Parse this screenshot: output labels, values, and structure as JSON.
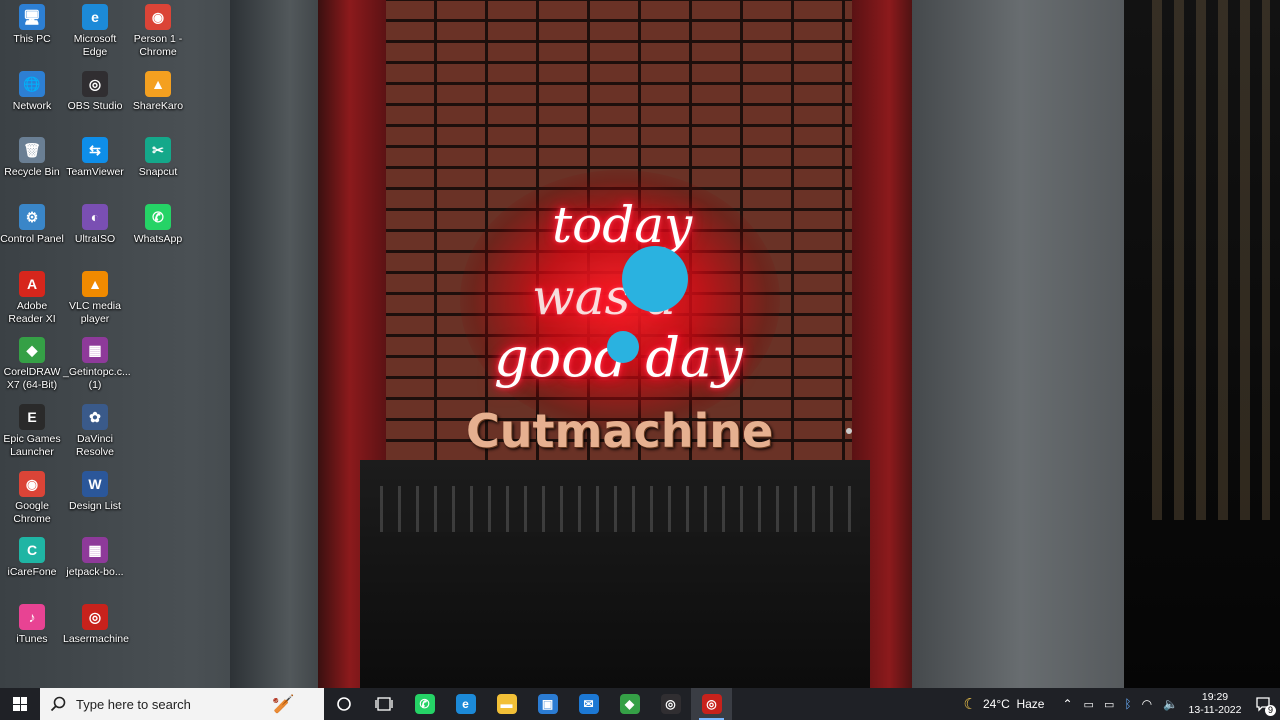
{
  "wallpaper": {
    "neon_lines": [
      "today",
      "was a",
      "good day"
    ],
    "watermark": "Cutmachine"
  },
  "desktop_icons": [
    {
      "label": "This PC",
      "glyph": "🖥",
      "color": "#2d7fd3",
      "name": "this-pc-icon"
    },
    {
      "label": "Microsoft Edge",
      "glyph": "e",
      "color": "#1c8ad8",
      "name": "edge-icon"
    },
    {
      "label": "Person 1 - Chrome",
      "glyph": "◉",
      "color": "#db4437",
      "name": "chrome-profile-icon"
    },
    {
      "label": "Network",
      "glyph": "🌐",
      "color": "#2d7fd3",
      "name": "network-icon"
    },
    {
      "label": "OBS Studio",
      "glyph": "◎",
      "color": "#302e31",
      "name": "obs-icon"
    },
    {
      "label": "ShareKaro",
      "glyph": "▲",
      "color": "#f4a020",
      "name": "sharekaro-icon"
    },
    {
      "label": "Recycle Bin",
      "glyph": "🗑",
      "color": "#6a7f94",
      "name": "recycle-bin-icon"
    },
    {
      "label": "TeamViewer",
      "glyph": "⇆",
      "color": "#0e8ee9",
      "name": "teamviewer-icon"
    },
    {
      "label": "Snapcut",
      "glyph": "✂",
      "color": "#14a88a",
      "name": "snapcut-icon"
    },
    {
      "label": "Control Panel",
      "glyph": "⚙",
      "color": "#3a86c8",
      "name": "control-panel-icon"
    },
    {
      "label": "UltraISO",
      "glyph": "◐",
      "color": "#7a4fb3",
      "name": "ultraiso-icon"
    },
    {
      "label": "WhatsApp",
      "glyph": "✆",
      "color": "#25d366",
      "name": "whatsapp-icon"
    },
    {
      "label": "Adobe Reader XI",
      "glyph": "A",
      "color": "#d7261c",
      "name": "adobe-reader-icon"
    },
    {
      "label": "VLC media player",
      "glyph": "▲",
      "color": "#f08a00",
      "name": "vlc-icon"
    },
    {
      "label": "CorelDRAW X7 (64-Bit)",
      "glyph": "◆",
      "color": "#35a046",
      "name": "coreldraw-icon"
    },
    {
      "label": "_Getintopc.c... (1)",
      "glyph": "▦",
      "color": "#8e3a9a",
      "name": "winrar-archive-icon"
    },
    {
      "label": "Epic Games Launcher",
      "glyph": "E",
      "color": "#2a2a2a",
      "name": "epic-games-icon"
    },
    {
      "label": "DaVinci Resolve",
      "glyph": "✿",
      "color": "#3a5a8a",
      "name": "davinci-resolve-icon"
    },
    {
      "label": "Google Chrome",
      "glyph": "◉",
      "color": "#db4437",
      "name": "google-chrome-icon"
    },
    {
      "label": "Design List",
      "glyph": "W",
      "color": "#2b579a",
      "name": "word-document-icon"
    },
    {
      "label": "iCareFone",
      "glyph": "C",
      "color": "#1fb5a4",
      "name": "icarefone-icon"
    },
    {
      "label": "jetpack-bo...",
      "glyph": "▦",
      "color": "#8e3a9a",
      "name": "winrar-archive-icon"
    },
    {
      "label": "iTunes",
      "glyph": "♪",
      "color": "#e84393",
      "name": "itunes-icon"
    },
    {
      "label": "Lasermachine",
      "glyph": "◎",
      "color": "#c8221c",
      "name": "lasermachine-icon"
    }
  ],
  "taskbar": {
    "search_placeholder": "Type here to search",
    "pinned": [
      {
        "name": "whatsapp",
        "color": "#25d366",
        "glyph": "✆"
      },
      {
        "name": "edge",
        "color": "#1c8ad8",
        "glyph": "e"
      },
      {
        "name": "file-explorer",
        "color": "#f2c037",
        "glyph": "▬"
      },
      {
        "name": "microsoft-store",
        "color": "#2b7cd3",
        "glyph": "▣"
      },
      {
        "name": "mail",
        "color": "#1c78d4",
        "glyph": "✉"
      },
      {
        "name": "coreldraw",
        "color": "#35a046",
        "glyph": "◆"
      },
      {
        "name": "obs-studio",
        "color": "#302e31",
        "glyph": "◎"
      },
      {
        "name": "lasermachine",
        "color": "#c8221c",
        "glyph": "◎"
      }
    ],
    "weather": "24°C  Haze",
    "time": "19:29",
    "date": "13-11-2022",
    "notification_count": "9"
  }
}
